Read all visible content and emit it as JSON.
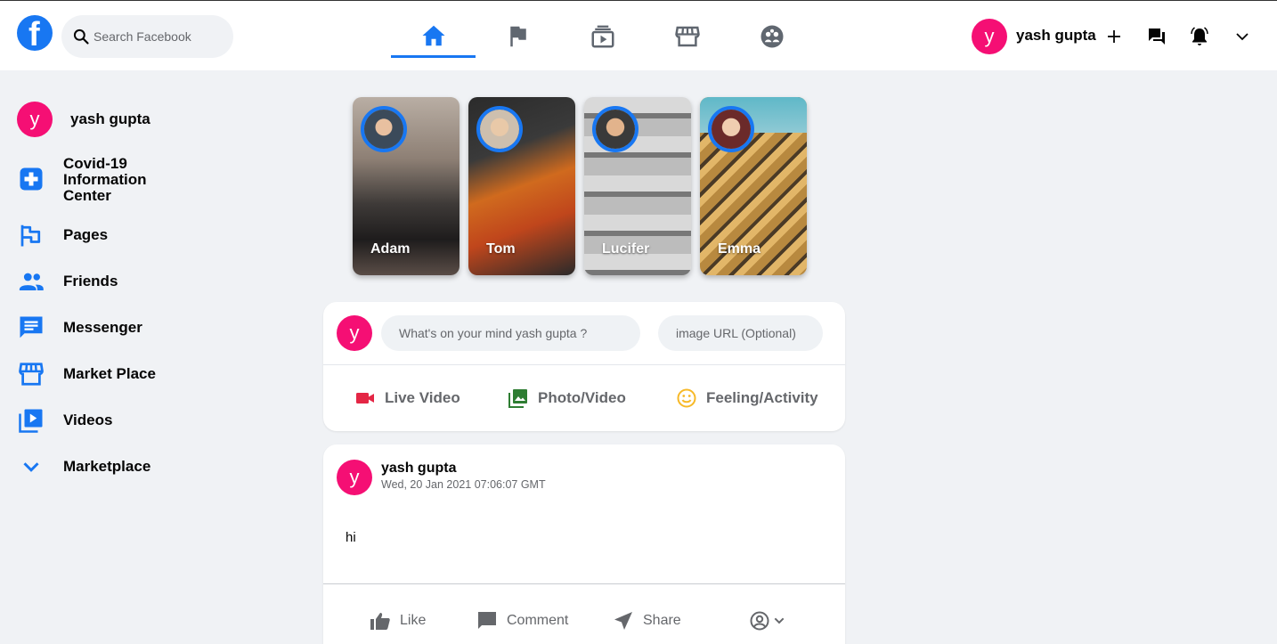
{
  "header": {
    "logo_letter": "f",
    "search_placeholder": "Search Facebook",
    "user_initial": "y",
    "user_name": "yash gupta"
  },
  "sidebar": {
    "user_initial": "y",
    "user_name": "yash gupta",
    "items": [
      {
        "label": "Covid-19\nInformation\nCenter",
        "icon": "medical-plus-icon"
      },
      {
        "label": "Pages",
        "icon": "flag-icon"
      },
      {
        "label": "Friends",
        "icon": "people-icon"
      },
      {
        "label": "Messenger",
        "icon": "chat-icon"
      },
      {
        "label": "Market Place",
        "icon": "store-icon"
      },
      {
        "label": "Videos",
        "icon": "video-library-icon"
      },
      {
        "label": "Marketplace",
        "icon": "chevron-down-icon"
      }
    ]
  },
  "stories": [
    {
      "name": "Adam"
    },
    {
      "name": "Tom"
    },
    {
      "name": "Lucifer"
    },
    {
      "name": "Emma"
    }
  ],
  "composer": {
    "user_initial": "y",
    "message_placeholder": "What's on your mind yash gupta ?",
    "image_placeholder": "image URL (Optional)",
    "actions": {
      "live": "Live Video",
      "photo": "Photo/Video",
      "feeling": "Feeling/Activity"
    }
  },
  "post": {
    "user_initial": "y",
    "user_name": "yash gupta",
    "timestamp": "Wed, 20 Jan 2021 07:06:07 GMT",
    "message": "hi",
    "actions": {
      "like": "Like",
      "comment": "Comment",
      "share": "Share"
    }
  },
  "colors": {
    "brand": "#1877f2",
    "avatar": "#f50f74",
    "live": "#e42645",
    "photo": "#45bd62",
    "feeling": "#f7b928"
  }
}
